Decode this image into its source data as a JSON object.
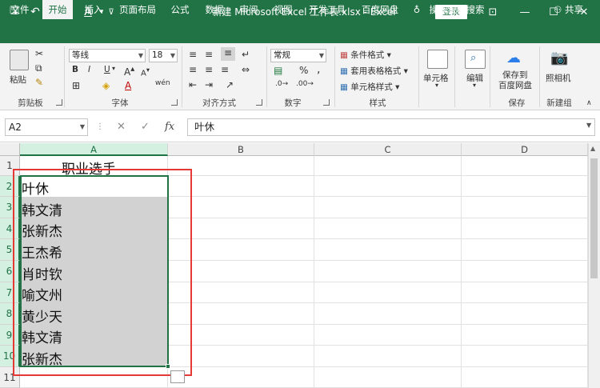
{
  "titlebar": {
    "title": "新建 Microsoft Excel 工作表.xlsx  -  Excel",
    "login": "登录",
    "save_glyph": "🖫",
    "undo_glyph": "↶",
    "redo_glyph": "↷",
    "fontcolor_glyph": "A",
    "qat_more_glyph": "⊽",
    "ribbon_display_glyph": "⊡",
    "minimize_glyph": "—",
    "maximize_glyph": "☐",
    "close_glyph": "✕"
  },
  "tabs": [
    {
      "label": "文件"
    },
    {
      "label": "开始"
    },
    {
      "label": "插入"
    },
    {
      "label": "页面布局"
    },
    {
      "label": "公式"
    },
    {
      "label": "数据"
    },
    {
      "label": "审阅"
    },
    {
      "label": "视图"
    },
    {
      "label": "开发工具"
    },
    {
      "label": "百度网盘"
    },
    {
      "label": "操作说明搜索"
    }
  ],
  "share": "共享",
  "ribbon": {
    "clipboard": {
      "paste": "粘贴",
      "label": "剪贴板"
    },
    "font": {
      "name": "等线",
      "size": "18",
      "bold": "B",
      "italic": "I",
      "underline": "U",
      "grow": "A",
      "shrink": "A",
      "color": "A",
      "phonetic": "wén",
      "label": "字体"
    },
    "align": {
      "label": "对齐方式"
    },
    "number": {
      "format": "常规",
      "percent": "%",
      "comma": ",",
      "label": "数字"
    },
    "styles": {
      "cond": "条件格式",
      "table": "套用表格格式",
      "cell": "单元格样式",
      "label": "样式"
    },
    "cells": {
      "btn": "单元格"
    },
    "edit": {
      "btn": "编辑"
    },
    "save": {
      "btn1": "保存到",
      "btn2": "百度网盘",
      "label": "保存"
    },
    "camera": {
      "btn": "照相机",
      "label": "新建组"
    }
  },
  "formula_bar": {
    "name_box": "A2",
    "cancel": "✕",
    "enter": "✓",
    "fx": "fx",
    "content": "叶休"
  },
  "sheet": {
    "columns": [
      "A",
      "B",
      "C",
      "D"
    ],
    "rows": [
      "1",
      "2",
      "3",
      "4",
      "5",
      "6",
      "7",
      "8",
      "9",
      "10",
      "11"
    ],
    "header": "职业选手",
    "names": [
      "叶休",
      "韩文清",
      "张新杰",
      "王杰希",
      "肖时钦",
      "喻文州",
      "黄少天",
      "韩文清",
      "张新杰"
    ]
  }
}
